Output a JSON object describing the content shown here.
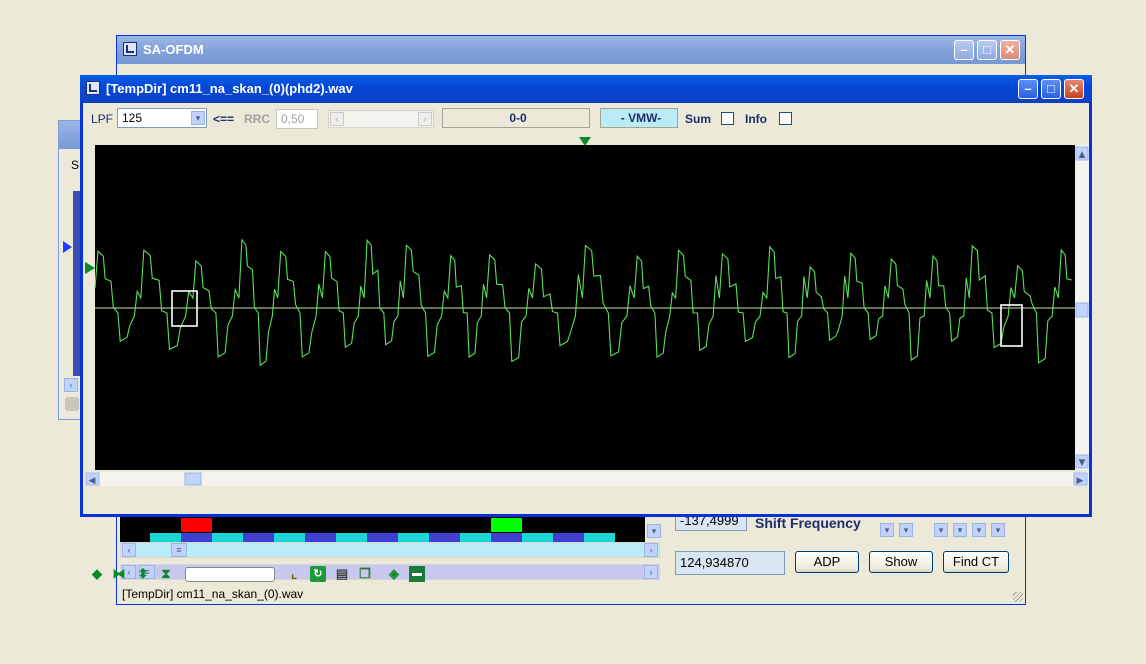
{
  "back_window": {
    "title": "SA-OFDM",
    "shift_value": "-137,4999",
    "shift_label": "Shift Frequency",
    "freq_value": "124,934870",
    "buttons": {
      "adp": "ADP",
      "show": "Show",
      "find_ct": "Find CT"
    },
    "status_text": "[TempDir] cm11_na_skan_(0).wav"
  },
  "left_window": {
    "letter": "S"
  },
  "main_window": {
    "title": "[TempDir] cm11_na_skan_(0)(phd2).wav",
    "lpf_label": "LPF",
    "lpf_value": "125",
    "arrow_label": "<==",
    "rrc_label": "RRC",
    "rrc_value": "0,50",
    "range_display": "0-0",
    "vmw_display": "- VMW-",
    "sum_label": "Sum",
    "info_label": "Info"
  },
  "colors": {
    "signal": "#59e05b",
    "plot_background": "#000000",
    "baseline": "#c8e6a0",
    "marker": "#0c8a2a",
    "vmw_background": "#b9ecf7",
    "red_bar": "#ff0000",
    "green_bar": "#00ff00"
  }
}
